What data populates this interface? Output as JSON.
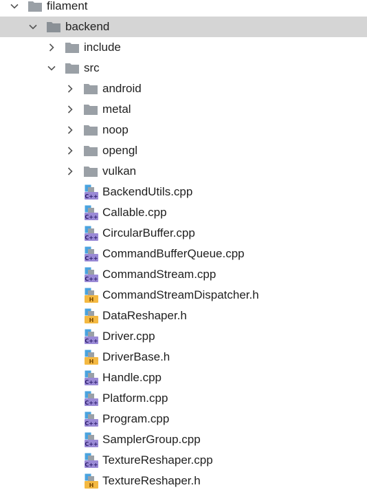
{
  "tree": {
    "filament": {
      "label": "filament",
      "expanded": true
    },
    "backend": {
      "label": "backend",
      "expanded": true,
      "selected": true
    },
    "include": {
      "label": "include",
      "expanded": false
    },
    "src": {
      "label": "src",
      "expanded": true
    },
    "src_folders": [
      {
        "label": "android",
        "expanded": false
      },
      {
        "label": "metal",
        "expanded": false
      },
      {
        "label": "noop",
        "expanded": false
      },
      {
        "label": "opengl",
        "expanded": false
      },
      {
        "label": "vulkan",
        "expanded": false
      }
    ],
    "src_files": [
      {
        "label": "BackendUtils.cpp",
        "type": "cpp",
        "badge": "C++"
      },
      {
        "label": "Callable.cpp",
        "type": "cpp",
        "badge": "C++"
      },
      {
        "label": "CircularBuffer.cpp",
        "type": "cpp",
        "badge": "C++"
      },
      {
        "label": "CommandBufferQueue.cpp",
        "type": "cpp",
        "badge": "C++"
      },
      {
        "label": "CommandStream.cpp",
        "type": "cpp",
        "badge": "C++"
      },
      {
        "label": "CommandStreamDispatcher.h",
        "type": "h",
        "badge": "H"
      },
      {
        "label": "DataReshaper.h",
        "type": "h",
        "badge": "H"
      },
      {
        "label": "Driver.cpp",
        "type": "cpp",
        "badge": "C++"
      },
      {
        "label": "DriverBase.h",
        "type": "h",
        "badge": "H"
      },
      {
        "label": "Handle.cpp",
        "type": "cpp",
        "badge": "C++"
      },
      {
        "label": "Platform.cpp",
        "type": "cpp",
        "badge": "C++"
      },
      {
        "label": "Program.cpp",
        "type": "cpp",
        "badge": "C++"
      },
      {
        "label": "SamplerGroup.cpp",
        "type": "cpp",
        "badge": "C++"
      },
      {
        "label": "TextureReshaper.cpp",
        "type": "cpp",
        "badge": "C++"
      },
      {
        "label": "TextureReshaper.h",
        "type": "h",
        "badge": "H"
      }
    ]
  },
  "colors": {
    "selected_row": "#d5d5d5",
    "folder": "#9aa0a6",
    "cpp_badge": "#9a8ad6",
    "h_badge": "#f4b942",
    "file_blue": "#4aa3df"
  }
}
